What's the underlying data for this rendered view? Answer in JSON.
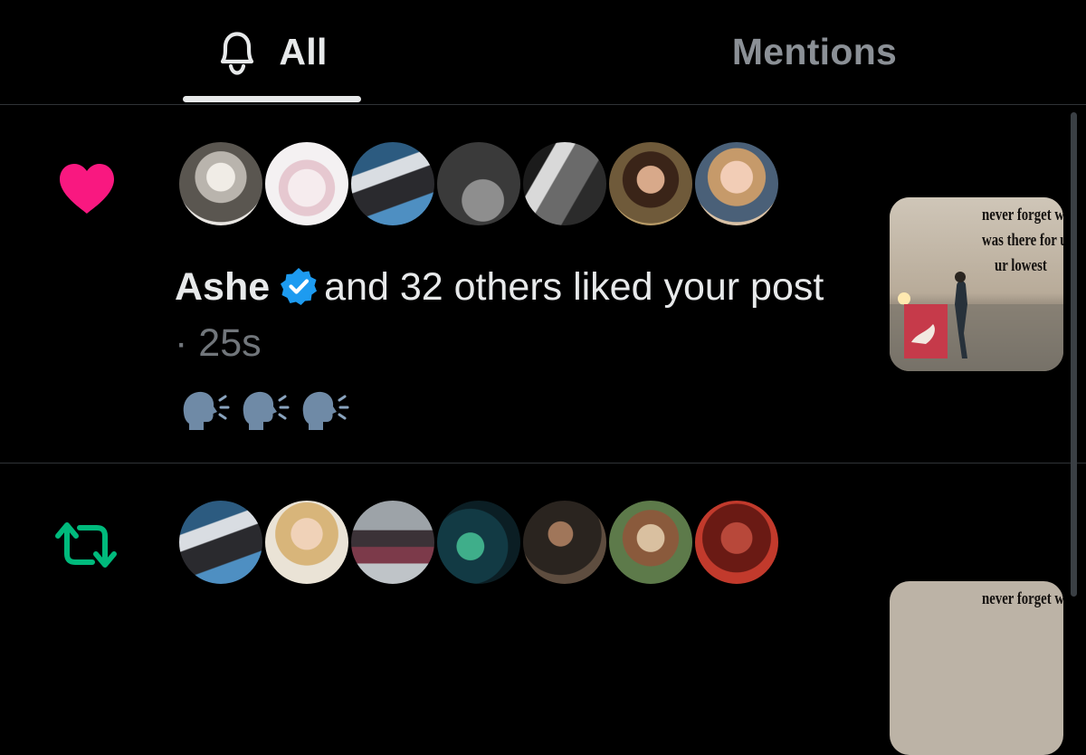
{
  "tabs": {
    "all": {
      "label": "All",
      "icon": "bell-icon",
      "selected": true
    },
    "mentions": {
      "label": "Mentions",
      "icon": null,
      "selected": false
    }
  },
  "notifications": [
    {
      "type": "like",
      "icon": "heart-icon",
      "icon_color": "#f91880",
      "avatars": [
        "avatar-1",
        "avatar-2",
        "avatar-3",
        "avatar-4",
        "avatar-5",
        "avatar-6",
        "avatar-7"
      ],
      "actor": "Ashe",
      "verified": true,
      "action_text": "and 32 others liked your post",
      "separator": "·",
      "time": "25s",
      "post_text": "🗣️🗣️🗣️",
      "thumbnail_text": [
        "never forget who",
        "was there for u at",
        "ur lowest"
      ]
    },
    {
      "type": "repost",
      "icon": "retweet-icon",
      "icon_color": "#00ba7c",
      "avatars": [
        "avatar-1",
        "avatar-2",
        "avatar-3",
        "avatar-4",
        "avatar-5",
        "avatar-6",
        "avatar-7"
      ],
      "thumbnail_text": [
        "never forget who"
      ]
    }
  ],
  "colors": {
    "background": "#000000",
    "text": "#e7e9ea",
    "muted": "#71767b",
    "divider": "#2f3336",
    "verified": "#1d9bf0"
  }
}
